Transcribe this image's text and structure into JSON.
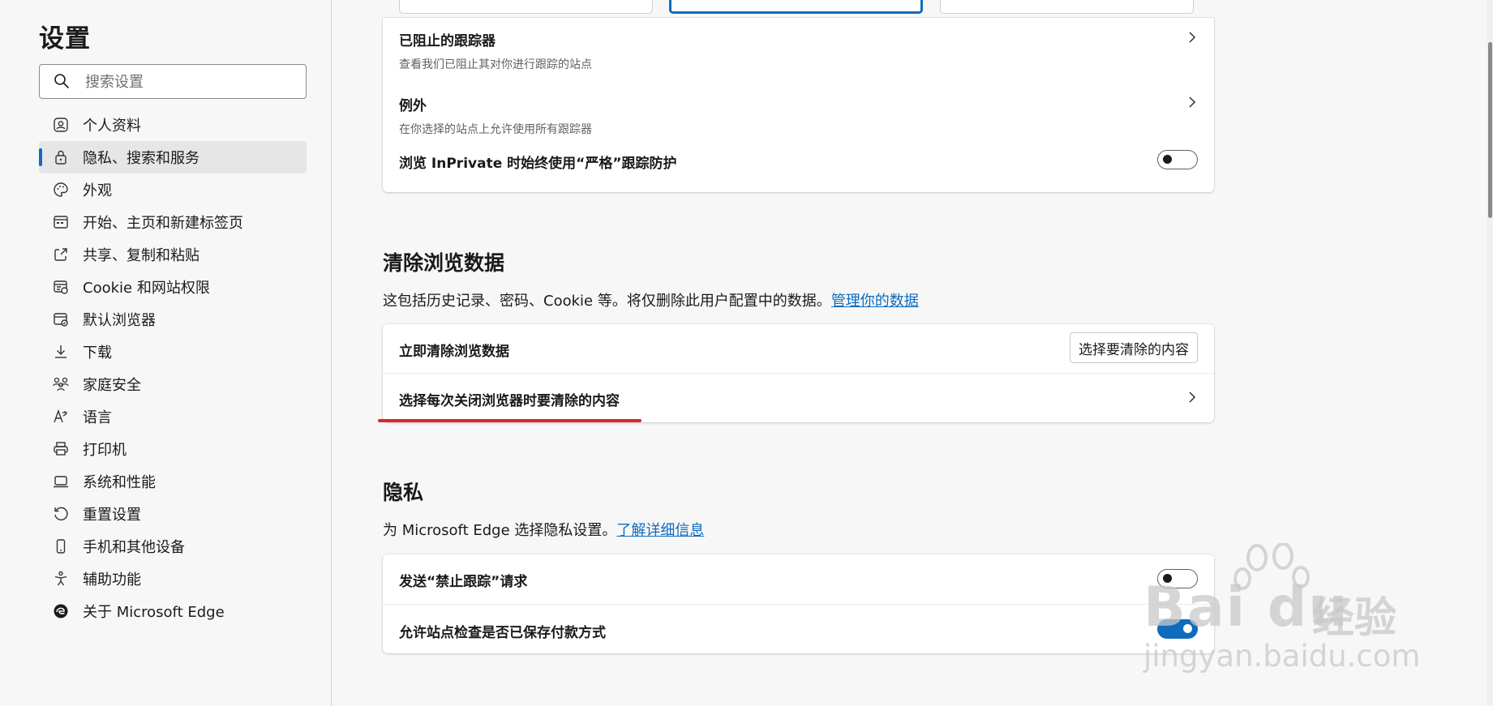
{
  "sidebar": {
    "title": "设置",
    "search_placeholder": "搜索设置",
    "items": [
      {
        "label": "个人资料",
        "icon": "profile-icon"
      },
      {
        "label": "隐私、搜索和服务",
        "icon": "lock-icon",
        "active": true
      },
      {
        "label": "外观",
        "icon": "palette-icon"
      },
      {
        "label": "开始、主页和新建标签页",
        "icon": "home-tabs-icon"
      },
      {
        "label": "共享、复制和粘贴",
        "icon": "share-icon"
      },
      {
        "label": "Cookie 和网站权限",
        "icon": "site-permissions-icon"
      },
      {
        "label": "默认浏览器",
        "icon": "default-browser-icon"
      },
      {
        "label": "下载",
        "icon": "download-icon"
      },
      {
        "label": "家庭安全",
        "icon": "family-icon"
      },
      {
        "label": "语言",
        "icon": "language-icon"
      },
      {
        "label": "打印机",
        "icon": "printer-icon"
      },
      {
        "label": "系统和性能",
        "icon": "laptop-icon"
      },
      {
        "label": "重置设置",
        "icon": "reset-icon"
      },
      {
        "label": "手机和其他设备",
        "icon": "phone-icon"
      },
      {
        "label": "辅助功能",
        "icon": "accessibility-icon"
      },
      {
        "label": "关于 Microsoft Edge",
        "icon": "edge-icon"
      }
    ]
  },
  "tracking": {
    "blocked_title": "已阻止的跟踪器",
    "blocked_sub": "查看我们已阻止其对你进行跟踪的站点",
    "exceptions_title": "例外",
    "exceptions_sub": "在你选择的站点上允许使用所有跟踪器",
    "inprivate_label": "浏览 InPrivate 时始终使用“严格”跟踪防护",
    "inprivate_on": false
  },
  "clear_data": {
    "title": "清除浏览数据",
    "desc": "这包括历史记录、密码、Cookie 等。将仅删除此用户配置中的数据。",
    "desc_link": "管理你的数据",
    "now_label": "立即清除浏览数据",
    "choose_button": "选择要清除的内容",
    "on_close_label": "选择每次关闭浏览器时要清除的内容"
  },
  "privacy": {
    "title": "隐私",
    "desc": "为 Microsoft Edge 选择隐私设置。",
    "desc_link": "了解详细信息",
    "dnt_label": "发送“禁止跟踪”请求",
    "dnt_on": false,
    "payment_label": "允许站点检查是否已保存付款方式",
    "payment_on": true
  },
  "watermark": {
    "brand": "Bai du",
    "cn": "经验",
    "url": "jingyan.baidu.com"
  },
  "colors": {
    "accent": "#0f6cbd",
    "highlight": "#d42b2b"
  }
}
